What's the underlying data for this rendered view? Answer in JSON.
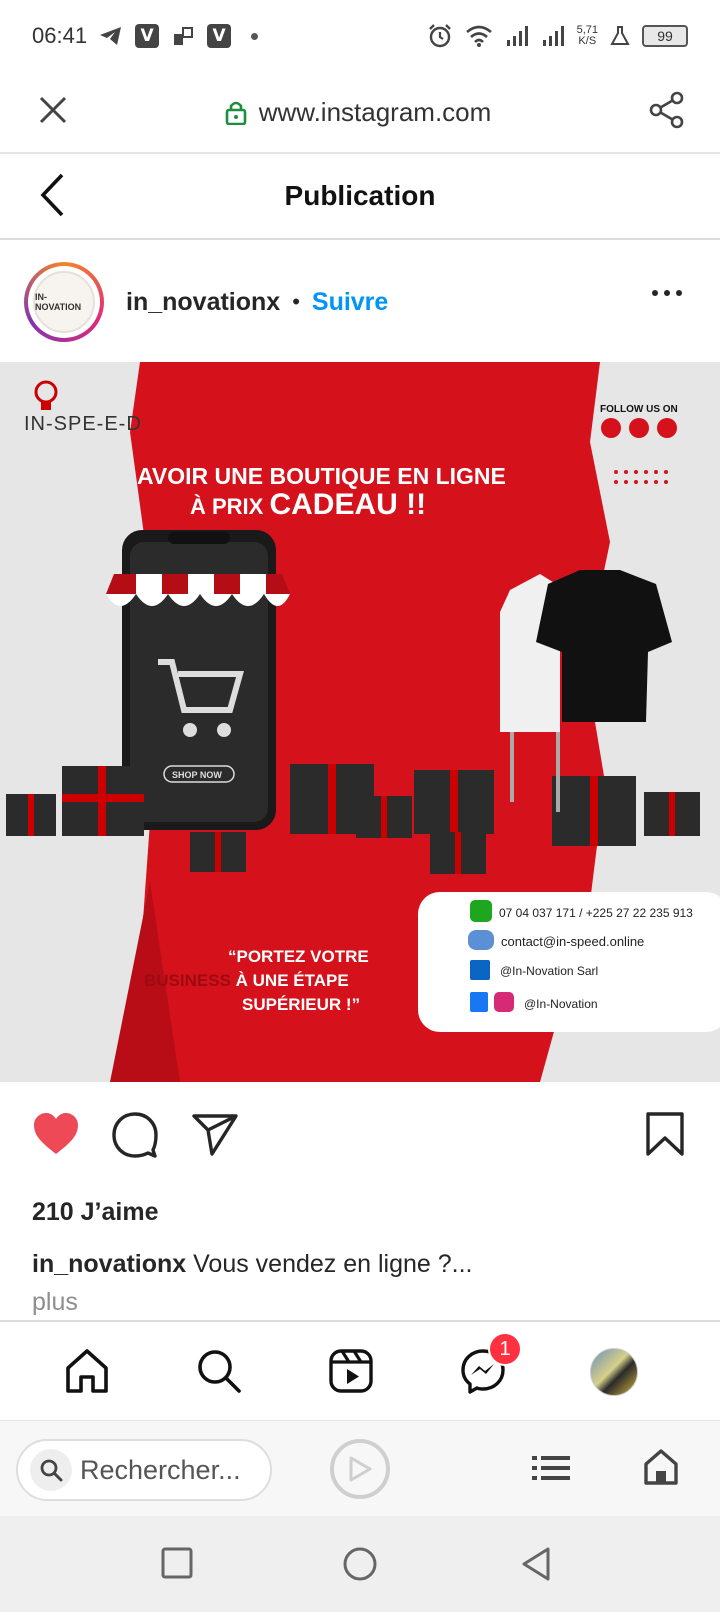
{
  "status_bar": {
    "time": "06:41",
    "v_badge": "V",
    "speed_value": "5,71",
    "speed_unit": "K/S",
    "battery": "99"
  },
  "browser": {
    "url": "www.instagram.com",
    "search_placeholder": "Rechercher..."
  },
  "header": {
    "title": "Publication"
  },
  "post": {
    "avatar_text": "IN-NOVATION",
    "username": "in_novationx",
    "separator": "•",
    "follow_label": "Suivre",
    "likes": "210 J’aime",
    "caption_user": "in_novationx",
    "caption_text": " Vous vendez en ligne ?...",
    "more_label": "plus"
  },
  "flyer": {
    "brand": "IN-SPE-E-D",
    "follow_us": "FOLLOW US ON",
    "headline_line1": "AVOIR UNE BOUTIQUE EN LIGNE",
    "headline_line2_a": "À PRIX ",
    "headline_line2_b": "CADEAU !!",
    "shop_now": "SHOP NOW",
    "slogan_line1": "“PORTEZ VOTRE",
    "slogan_line2_a": "BUSINESS",
    "slogan_line2_b": " À UNE ÉTAPE",
    "slogan_line3": "SUPÉRIEUR !”",
    "phone": "07 04 037 171 / +225 27 22 235 913",
    "email": "contact@in-speed.online",
    "linkedin": "@In-Novation Sarl",
    "social": "@In-Novation"
  },
  "nav": {
    "messenger_badge": "1"
  },
  "colors": {
    "follow_blue": "#0095f6",
    "like_red": "#ed4956",
    "flyer_red": "#d5111b"
  }
}
